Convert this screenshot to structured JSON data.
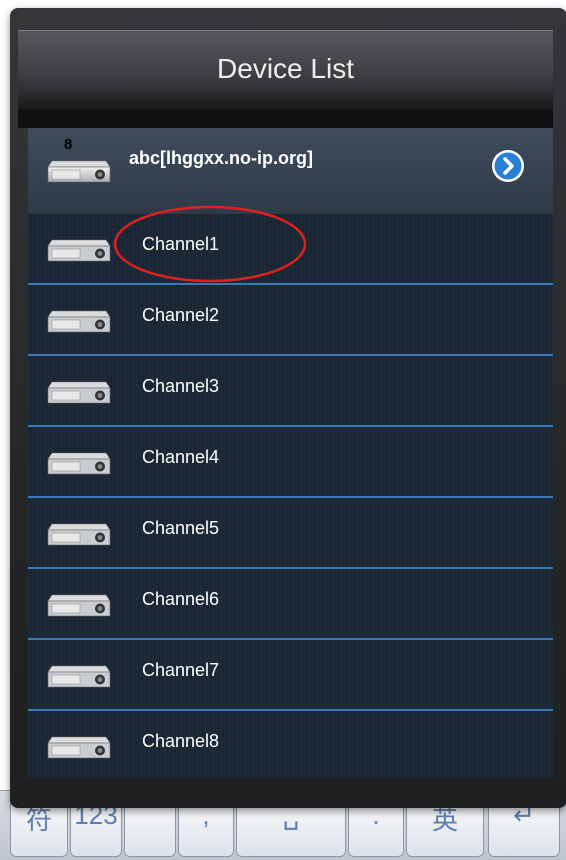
{
  "window": {
    "title": "Device List"
  },
  "device": {
    "label": "abc[lhggxx.no-ip.org]",
    "channel_count": "8",
    "icon": "dvr-icon",
    "action_icon": "chevron-right-icon"
  },
  "channels": [
    {
      "label": "Channel1",
      "highlighted": true
    },
    {
      "label": "Channel2"
    },
    {
      "label": "Channel3"
    },
    {
      "label": "Channel4"
    },
    {
      "label": "Channel5"
    },
    {
      "label": "Channel6"
    },
    {
      "label": "Channel7"
    },
    {
      "label": "Channel8"
    }
  ],
  "keyboard": {
    "keys": [
      "符",
      "123",
      "",
      ",",
      "␣",
      ".",
      "英",
      "↵"
    ]
  },
  "colors": {
    "accent": "#3c78b8",
    "highlight_circle": "#e02020",
    "arrow_button": "#2a7fd4"
  }
}
